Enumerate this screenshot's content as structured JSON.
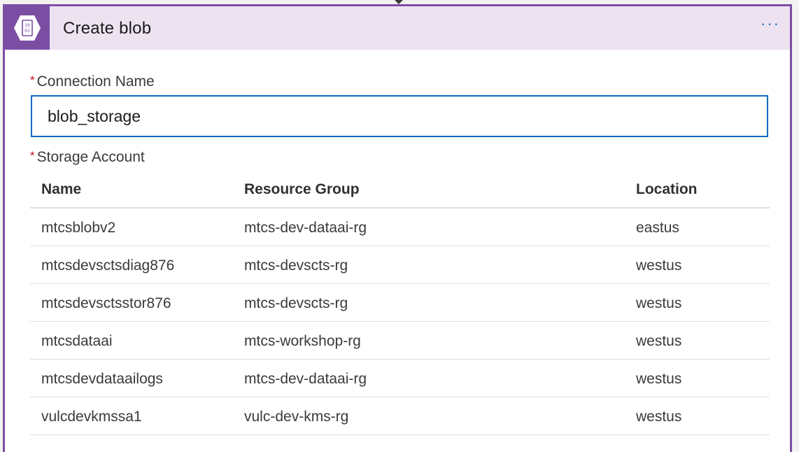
{
  "header": {
    "title": "Create blob",
    "more_label": "···",
    "icon_lines": [
      "10",
      "01"
    ]
  },
  "form": {
    "required_mark": "*",
    "connection_label": "Connection Name",
    "connection_value": "blob_storage",
    "storage_label": "Storage Account"
  },
  "table": {
    "columns": [
      "Name",
      "Resource Group",
      "Location"
    ],
    "rows": [
      {
        "name": "mtcsblobv2",
        "group": "mtcs-dev-dataai-rg",
        "location": "eastus"
      },
      {
        "name": "mtcsdevsctsdiag876",
        "group": "mtcs-devscts-rg",
        "location": "westus"
      },
      {
        "name": "mtcsdevsctsstor876",
        "group": "mtcs-devscts-rg",
        "location": "westus"
      },
      {
        "name": "mtcsdataai",
        "group": "mtcs-workshop-rg",
        "location": "westus"
      },
      {
        "name": "mtcsdevdataailogs",
        "group": "mtcs-dev-dataai-rg",
        "location": "westus"
      },
      {
        "name": "vulcdevkmssa1",
        "group": "vulc-dev-kms-rg",
        "location": "westus"
      }
    ]
  },
  "colors": {
    "accent_purple": "#7b4ea3",
    "header_bg": "#ece2f0",
    "focus_blue": "#0f6cbd",
    "required_red": "#c50f1f"
  }
}
